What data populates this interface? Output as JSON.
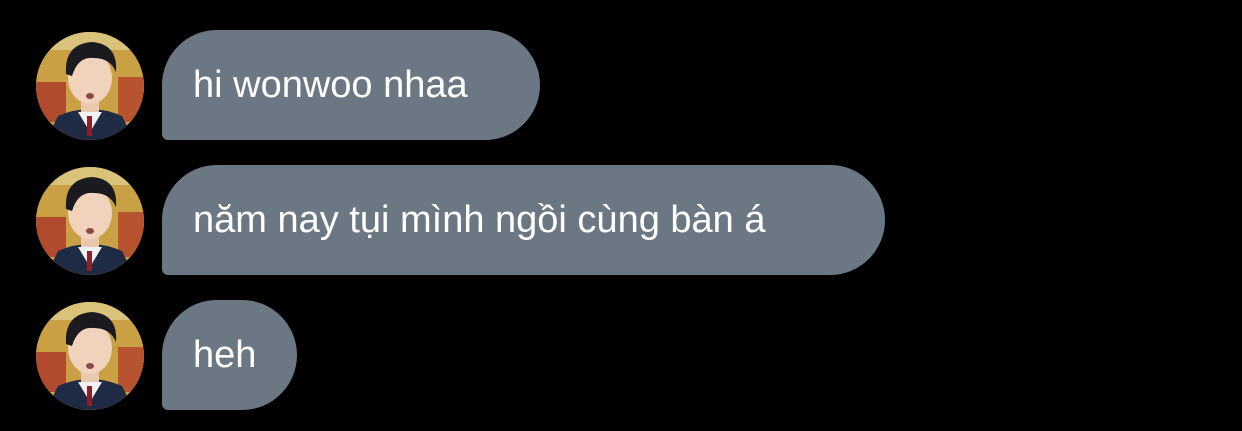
{
  "messages": [
    {
      "sender_avatar": "profile-photo",
      "text": "hi wonwoo nhaa"
    },
    {
      "sender_avatar": "profile-photo",
      "text": "năm nay tụi mình ngồi cùng bàn á"
    },
    {
      "sender_avatar": "profile-photo",
      "text": "heh"
    }
  ],
  "colors": {
    "background": "#000000",
    "bubble": "#6b7884",
    "bubble_text": "#ffffff"
  }
}
